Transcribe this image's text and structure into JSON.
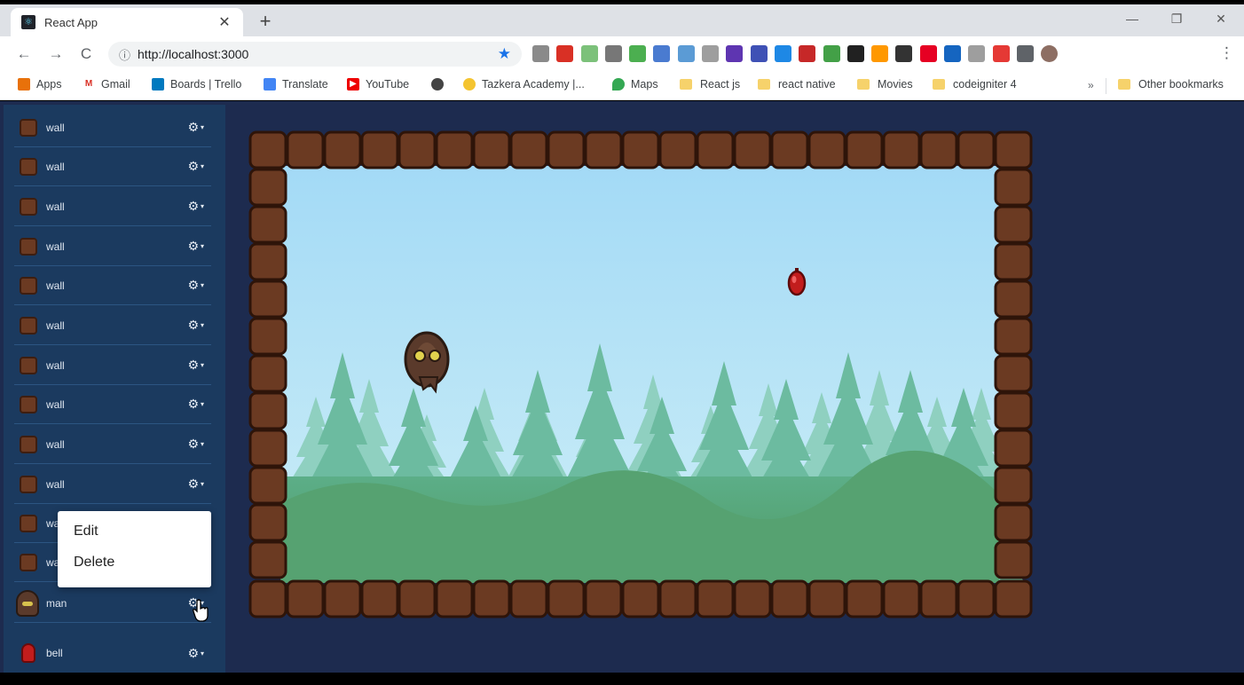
{
  "browser": {
    "tab_title": "React App",
    "tab_close": "✕",
    "new_tab": "+",
    "window_controls": {
      "minimize": "—",
      "restore": "❐",
      "close": "✕"
    },
    "nav": {
      "back": "←",
      "forward": "→",
      "reload": "C"
    },
    "address": {
      "info_icon": "ⓘ",
      "url": "http://localhost:3000"
    },
    "bookmarks": [
      {
        "label": "Apps",
        "icon": "apps-grid-icon"
      },
      {
        "label": "Gmail",
        "icon": "gmail-icon"
      },
      {
        "label": "Boards | Trello",
        "icon": "trello-icon"
      },
      {
        "label": "Translate",
        "icon": "translate-icon"
      },
      {
        "label": "YouTube",
        "icon": "youtube-icon"
      },
      {
        "label": "",
        "icon": "globe-icon"
      },
      {
        "label": "Tazkera Academy |...",
        "icon": "tazkera-icon"
      },
      {
        "label": "Maps",
        "icon": "maps-icon"
      },
      {
        "label": "React js",
        "icon": "folder-icon"
      },
      {
        "label": "react native",
        "icon": "folder-icon"
      },
      {
        "label": "Movies",
        "icon": "folder-icon"
      },
      {
        "label": "codeigniter 4",
        "icon": "folder-icon"
      }
    ],
    "bookmarks_overflow": "»",
    "other_bookmarks": "Other bookmarks"
  },
  "sidebar": {
    "entities": [
      {
        "label": "wall",
        "type": "wall"
      },
      {
        "label": "wall",
        "type": "wall"
      },
      {
        "label": "wall",
        "type": "wall"
      },
      {
        "label": "wall",
        "type": "wall"
      },
      {
        "label": "wall",
        "type": "wall"
      },
      {
        "label": "wall",
        "type": "wall"
      },
      {
        "label": "wall",
        "type": "wall"
      },
      {
        "label": "wall",
        "type": "wall"
      },
      {
        "label": "wall",
        "type": "wall"
      },
      {
        "label": "wall",
        "type": "wall"
      },
      {
        "label": "wall",
        "type": "wall"
      },
      {
        "label": "wall",
        "type": "wall"
      },
      {
        "label": "man",
        "type": "man"
      },
      {
        "label": "bell",
        "type": "bell"
      }
    ],
    "gear_glyph": "⚙",
    "caret_glyph": "▾"
  },
  "context_menu": {
    "edit": "Edit",
    "delete": "Delete"
  },
  "colors": {
    "sidebar_bg": "#1b3a5f",
    "app_bg": "#1d2b4f",
    "sky": "#a6dbf5",
    "block": "#6b3a22"
  }
}
